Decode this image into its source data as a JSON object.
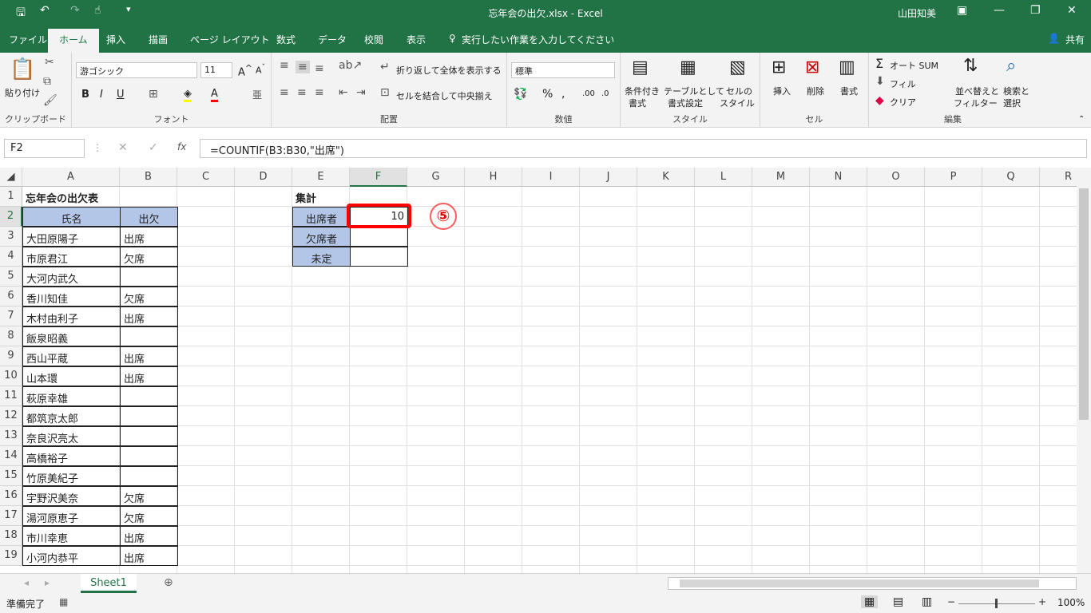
{
  "window": {
    "title": "忘年会の出欠.xlsx  -  Excel",
    "user": "山田知美",
    "share": "共有"
  },
  "tabs": [
    "ファイル",
    "ホーム",
    "挿入",
    "描画",
    "ページ レイアウト",
    "数式",
    "データ",
    "校閲",
    "表示"
  ],
  "tell_me": "実行したい作業を入力してください",
  "ribbon": {
    "clipboard": {
      "label": "クリップボード",
      "paste": "貼り付け"
    },
    "font": {
      "label": "フォント",
      "name": "游ゴシック",
      "size": "11"
    },
    "alignment": {
      "label": "配置",
      "wrap": "折り返して全体を表示する",
      "merge": "セルを結合して中央揃え"
    },
    "number": {
      "label": "数値",
      "format": "標準"
    },
    "styles": {
      "label": "スタイル",
      "cond": [
        "条件付き",
        "書式"
      ],
      "table": [
        "テーブルとして",
        "書式設定"
      ],
      "cell": [
        "セルの",
        "スタイル"
      ]
    },
    "cells": {
      "label": "セル",
      "insert": "挿入",
      "delete": "削除",
      "format": "書式"
    },
    "editing": {
      "label": "編集",
      "autosum": "オート SUM",
      "fill": "フィル",
      "clear": "クリア",
      "sort": [
        "並べ替えと",
        "フィルター"
      ],
      "find": [
        "検索と",
        "選択"
      ]
    }
  },
  "namebox": "F2",
  "formula": "=COUNTIF(B3:B30,\"出席\")",
  "columns": [
    "A",
    "B",
    "C",
    "D",
    "E",
    "F",
    "G",
    "H",
    "I",
    "J",
    "K",
    "L",
    "M",
    "N",
    "O",
    "P",
    "Q",
    "R"
  ],
  "rows": [
    "1",
    "2",
    "3",
    "4",
    "5",
    "6",
    "7",
    "8",
    "9",
    "10",
    "11",
    "12",
    "13",
    "14",
    "15",
    "16",
    "17",
    "18",
    "19"
  ],
  "sheet": {
    "title": "忘年会の出欠表",
    "header": [
      "氏名",
      "出欠"
    ],
    "entries": [
      [
        "大田原陽子",
        "出席"
      ],
      [
        "市原君江",
        "欠席"
      ],
      [
        "大河内武久",
        ""
      ],
      [
        "香川知佳",
        "欠席"
      ],
      [
        "木村由利子",
        "出席"
      ],
      [
        "飯泉昭義",
        ""
      ],
      [
        "西山平蔵",
        "出席"
      ],
      [
        "山本環",
        "出席"
      ],
      [
        "萩原幸雄",
        ""
      ],
      [
        "都筑京太郎",
        ""
      ],
      [
        "奈良沢亮太",
        ""
      ],
      [
        "高橋裕子",
        ""
      ],
      [
        "竹原美紀子",
        ""
      ],
      [
        "宇野沢美奈",
        "欠席"
      ],
      [
        "湯河原恵子",
        "欠席"
      ],
      [
        "市川幸恵",
        "出席"
      ],
      [
        "小河内恭平",
        "出席"
      ]
    ],
    "summary_title": "集計",
    "summary": [
      {
        "label": "出席者",
        "value": "10"
      },
      {
        "label": "欠席者",
        "value": ""
      },
      {
        "label": "未定",
        "value": ""
      }
    ]
  },
  "annotation": "⑤",
  "sheet_tab": "Sheet1",
  "status": {
    "ready": "準備完了",
    "zoom": "100%"
  }
}
